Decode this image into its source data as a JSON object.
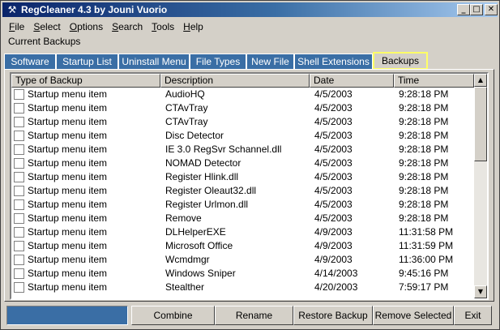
{
  "window": {
    "title": "RegCleaner 4.3 by Jouni Vuorio",
    "controls": {
      "minimize": "_",
      "maximize": "□",
      "close": "✕"
    }
  },
  "menu": [
    {
      "key": "F",
      "rest": "ile"
    },
    {
      "key": "S",
      "rest": "elect"
    },
    {
      "key": "O",
      "rest": "ptions"
    },
    {
      "key": "S",
      "rest": "earch"
    },
    {
      "key": "T",
      "rest": "ools"
    },
    {
      "key": "H",
      "rest": "elp"
    }
  ],
  "section_label": "Current Backups",
  "tabs": [
    "Software",
    "Startup List",
    "Uninstall Menu",
    "File Types",
    "New File",
    "Shell Extensions",
    "Backups"
  ],
  "table": {
    "columns": [
      "Type of Backup",
      "Description",
      "Date",
      "Time"
    ],
    "rows": [
      [
        "Startup menu item",
        "AudioHQ",
        "4/5/2003",
        "9:28:18 PM"
      ],
      [
        "Startup menu item",
        "CTAvTray",
        "4/5/2003",
        "9:28:18 PM"
      ],
      [
        "Startup menu item",
        "CTAvTray",
        "4/5/2003",
        "9:28:18 PM"
      ],
      [
        "Startup menu item",
        "Disc Detector",
        "4/5/2003",
        "9:28:18 PM"
      ],
      [
        "Startup menu item",
        "IE 3.0 RegSvr Schannel.dll",
        "4/5/2003",
        "9:28:18 PM"
      ],
      [
        "Startup menu item",
        "NOMAD Detector",
        "4/5/2003",
        "9:28:18 PM"
      ],
      [
        "Startup menu item",
        "Register Hlink.dll",
        "4/5/2003",
        "9:28:18 PM"
      ],
      [
        "Startup menu item",
        "Register Oleaut32.dll",
        "4/5/2003",
        "9:28:18 PM"
      ],
      [
        "Startup menu item",
        "Register Urlmon.dll",
        "4/5/2003",
        "9:28:18 PM"
      ],
      [
        "Startup menu item",
        "Remove",
        "4/5/2003",
        "9:28:18 PM"
      ],
      [
        "Startup menu item",
        "DLHelperEXE",
        "4/9/2003",
        "11:31:58 PM"
      ],
      [
        "Startup menu item",
        "Microsoft Office",
        "4/9/2003",
        "11:31:59 PM"
      ],
      [
        "Startup menu item",
        "Wcmdmgr",
        "4/9/2003",
        "11:36:00 PM"
      ],
      [
        "Startup menu item",
        "Windows Sniper",
        "4/14/2003",
        "9:45:16 PM"
      ],
      [
        "Startup menu item",
        "Stealther",
        "4/20/2003",
        "7:59:17 PM"
      ]
    ]
  },
  "scrollbar": {
    "up": "▲",
    "down": "▼"
  },
  "buttons": [
    "Combine",
    "Rename",
    "Restore Backup",
    "Remove Selected",
    "Exit"
  ],
  "colors": {
    "accent": "#3a6ea5",
    "highlight": "#ffff66",
    "face": "#d4d0c8"
  }
}
